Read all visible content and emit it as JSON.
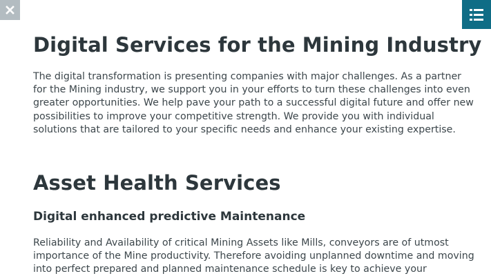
{
  "close_button": {
    "icon": "close-icon",
    "glyph": "✕"
  },
  "menu_button": {
    "icon": "list-menu-icon"
  },
  "section_intro": {
    "title": "Digital Services for the Mining Industry",
    "body": "The digital transformation is presenting companies with major challenges. As a partner for the Mining industry, we support you in your efforts to turn these challenges into even greater opportunities. We help pave your path to a successful digital future and offer new possibilities to improve your competitive strength. We provide you with individual solutions that are tailored to your specific needs and enhance your existing expertise."
  },
  "section_asset": {
    "title": "Asset Health Services",
    "subtitle": "Digital enhanced predictive Maintenance",
    "body": "Reliability and Availability of critical Mining Assets like Mills, conveyors are of utmost importance of the Mine productivity. Therefore avoiding unplanned downtime and moving into perfect prepared and planned maintenance schedule is key to achieve your production"
  },
  "colors": {
    "menu_bg": "#0f6d86",
    "close_bg": "#b3bcc1",
    "heading": "#2d373c",
    "text": "#3c464b"
  }
}
